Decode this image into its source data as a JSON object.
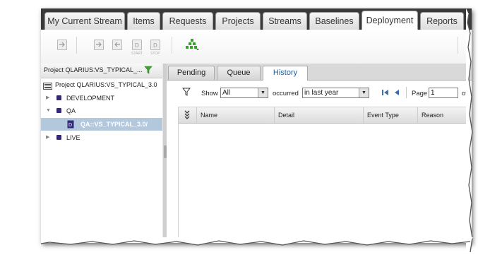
{
  "top_tabs": [
    "My Current Stream",
    "Items",
    "Requests",
    "Projects",
    "Streams",
    "Baselines",
    "Deployment",
    "Reports"
  ],
  "active_top_tab": "Deployment",
  "toolbar": {
    "icons": [
      "deploy-icon",
      "promote-icon",
      "demote-icon",
      "deploy-start-icon",
      "deploy-stop-icon",
      "hierarchy-chart-icon"
    ],
    "tiny_labels": [
      "START",
      "STOP"
    ]
  },
  "tree": {
    "project_selector": "Project QLARIUS:VS_TYPICAL_...",
    "root": "Project QLARIUS:VS_TYPICAL_3.0",
    "nodes": [
      {
        "label": "DEVELOPMENT",
        "expanded": false
      },
      {
        "label": "QA",
        "expanded": true
      },
      {
        "label": "QA::VS_TYPICAL_3.0/",
        "selected": true
      },
      {
        "label": "LIVE",
        "expanded": false
      }
    ]
  },
  "sub_tabs": [
    "Pending",
    "Queue",
    "History"
  ],
  "active_sub_tab": "History",
  "filter": {
    "show_label": "Show",
    "show_value": "All",
    "occurred_label": "occurred",
    "occurred_value": "in last year",
    "page_label": "Page",
    "page_value": "1",
    "of_label": "of"
  },
  "grid": {
    "columns": [
      "Name",
      "Detail",
      "Event Type",
      "Reason"
    ],
    "rows": []
  },
  "colors": {
    "tab_bar": "#3a3a3a",
    "selected_node": "#b3c7dd",
    "node_bullet": "#33297a",
    "active_subtab_text": "#1f5b9a",
    "filter_icon_green": "#3aa12f"
  }
}
